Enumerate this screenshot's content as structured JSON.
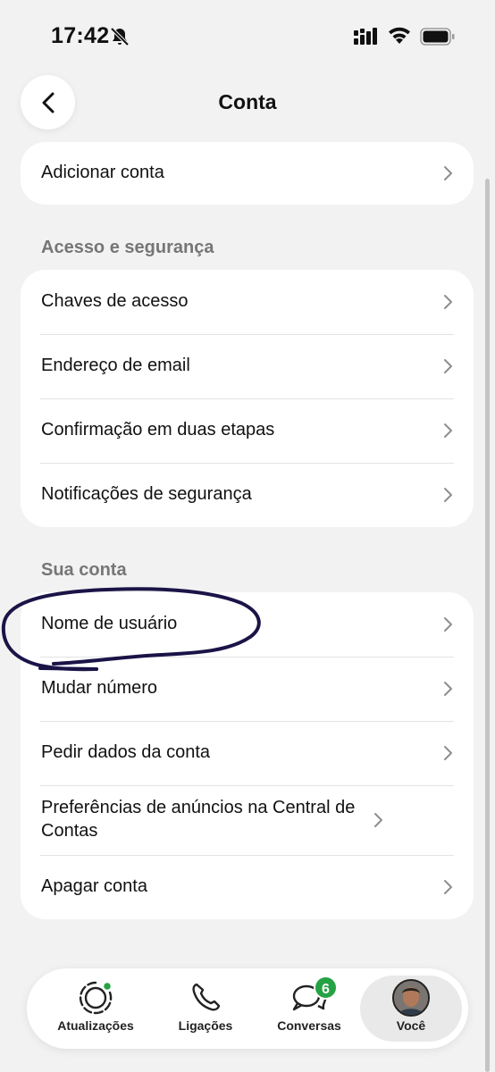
{
  "status_bar": {
    "time": "17:42",
    "icons": [
      "bell-off-icon",
      "signal-icon",
      "wifi-icon",
      "battery-icon"
    ]
  },
  "header": {
    "title": "Conta",
    "back_icon": "chevron-left-icon"
  },
  "top_card": {
    "items": [
      {
        "label": "Adicionar conta"
      }
    ]
  },
  "security_section": {
    "title": "Acesso e segurança",
    "items": [
      {
        "label": "Chaves de acesso"
      },
      {
        "label": "Endereço de email"
      },
      {
        "label": "Confirmação em duas etapas"
      },
      {
        "label": "Notificações de segurança"
      }
    ]
  },
  "account_section": {
    "title": "Sua conta",
    "items": [
      {
        "label": "Nome de usuário"
      },
      {
        "label": "Mudar número"
      },
      {
        "label": "Pedir dados da conta"
      },
      {
        "label": "Preferências de anúncios na Central de Contas"
      },
      {
        "label": "Apagar conta"
      }
    ]
  },
  "tab_bar": {
    "tabs": [
      {
        "label": "Atualizações",
        "icon": "status-updates-icon"
      },
      {
        "label": "Ligações",
        "icon": "phone-icon"
      },
      {
        "label": "Conversas",
        "icon": "chats-icon",
        "badge": "6"
      },
      {
        "label": "Você",
        "icon": "avatar",
        "active": true
      }
    ]
  },
  "colors": {
    "background": "#f2f2f2",
    "card": "#ffffff",
    "badge": "#25a244",
    "annotation": "#1a1447"
  }
}
